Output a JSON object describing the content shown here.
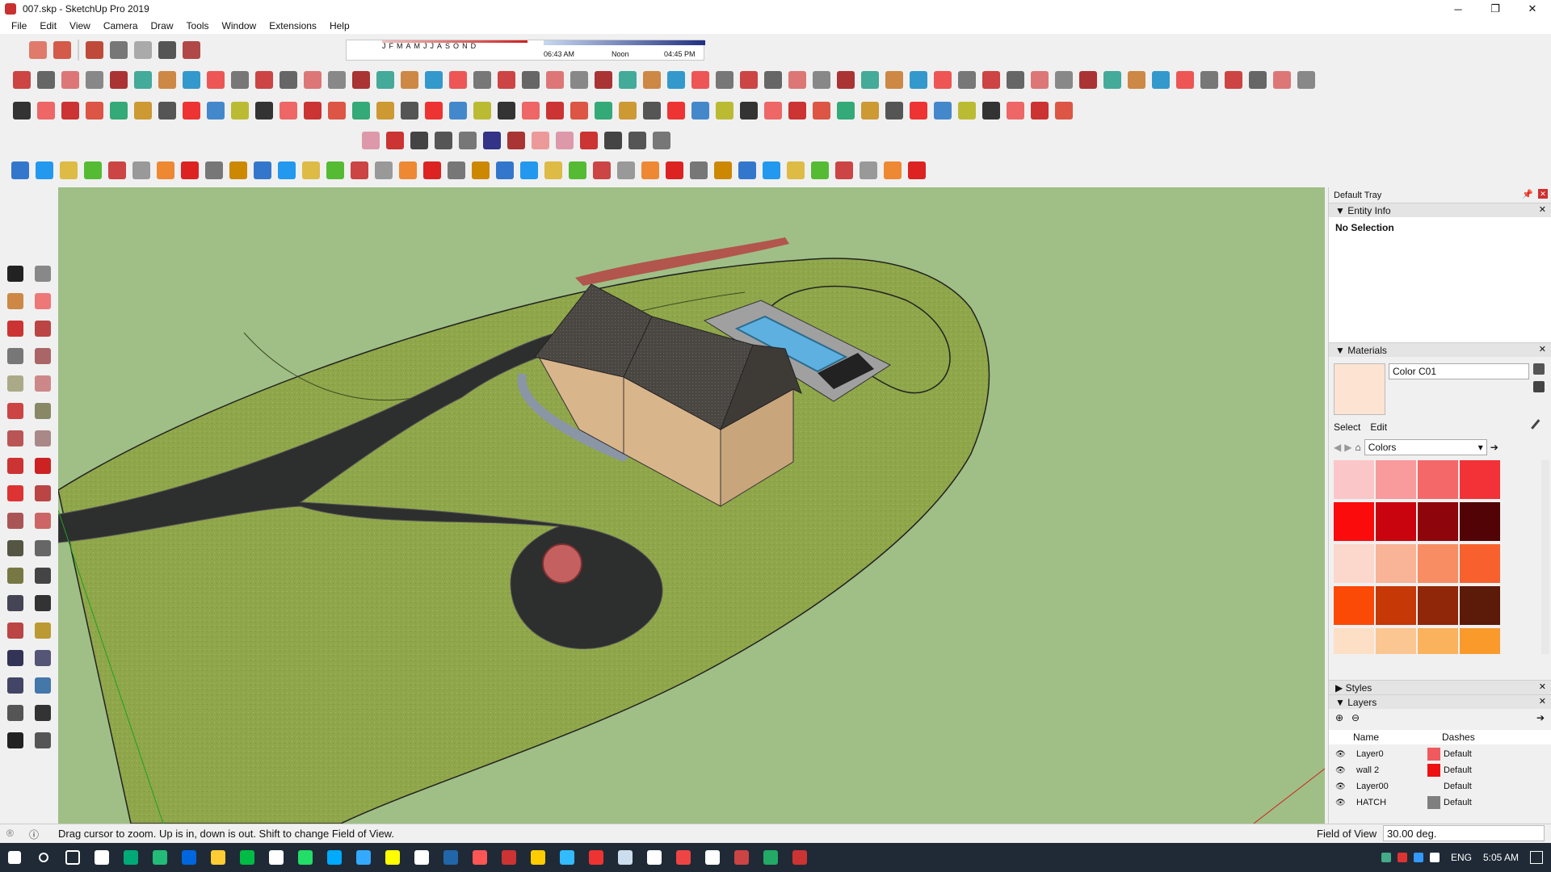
{
  "window": {
    "title": "007.skp - SketchUp Pro 2019",
    "controls": {
      "minimize": "─",
      "restore": "❐",
      "close": "✕"
    }
  },
  "menu": [
    "File",
    "Edit",
    "View",
    "Camera",
    "Draw",
    "Tools",
    "Window",
    "Extensions",
    "Help"
  ],
  "shadows": {
    "months": [
      "J",
      "F",
      "M",
      "A",
      "M",
      "J",
      "J",
      "A",
      "S",
      "O",
      "N",
      "D"
    ],
    "start_time": "06:43 AM",
    "noon": "Noon",
    "end_time": "04:45 PM"
  },
  "tray": {
    "title": "Default Tray",
    "entity_info": {
      "header": "Entity Info",
      "selection": "No Selection"
    },
    "materials": {
      "header": "Materials",
      "material_name": "Color C01",
      "preview_color": "#fde3d2",
      "tabs": [
        "Select",
        "Edit"
      ],
      "library": "Colors",
      "swatches": [
        "#fbc6c8",
        "#f99a9c",
        "#f5686a",
        "#f23236",
        "#fb0b0b",
        "#c9040e",
        "#8e050b",
        "#520306",
        "#fbd7cc",
        "#f9b397",
        "#f88d63",
        "#f8612d",
        "#fb4a06",
        "#c63806",
        "#8f2708",
        "#5c1a08",
        "#fddfc6",
        "#fbc691",
        "#fab25d",
        "#f99a2b"
      ]
    },
    "styles": {
      "header": "Styles"
    },
    "layers": {
      "header": "Layers",
      "col_name": "Name",
      "col_dashes": "Dashes",
      "rows": [
        {
          "name": "Layer0",
          "color": "#f05a5e",
          "dashes": "Default"
        },
        {
          "name": "wall 2",
          "color": "#ee1111",
          "dashes": "Default"
        },
        {
          "name": "Layer00",
          "color": "#f0f0f0",
          "dashes": "Default"
        },
        {
          "name": "HATCH",
          "color": "#7f7f7f",
          "dashes": "Default"
        }
      ]
    }
  },
  "status": {
    "hint": "Drag cursor to zoom.  Up is in, down is out. Shift to change Field of View.",
    "fov_label": "Field of View",
    "fov_value": "30.00 deg."
  },
  "taskbar": {
    "lang": "ENG",
    "time": "5:05 AM"
  },
  "colors": {
    "grass": "#8fa64a",
    "sky": "#9fbf86",
    "asphalt": "#2d2e2e",
    "roof": "#4a4743",
    "wall": "#d9b58c",
    "pool": "#5eb0e0"
  }
}
